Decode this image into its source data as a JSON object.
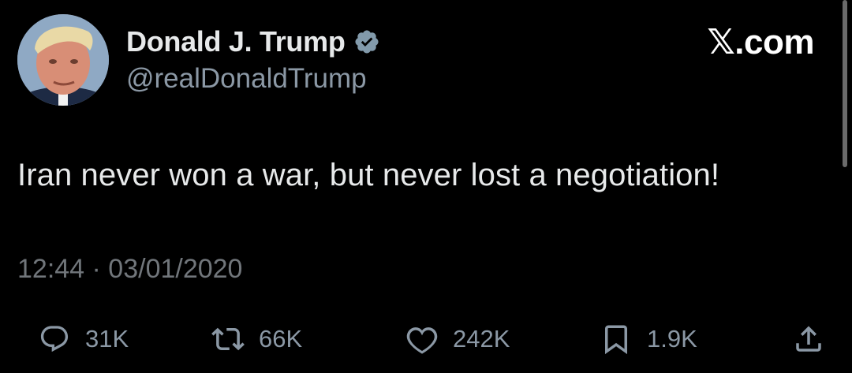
{
  "author": {
    "display_name": "Donald J. Trump",
    "handle": "@realDonaldTrump",
    "verified": true
  },
  "source_label": "𝕏.com",
  "tweet": {
    "text": "Iran never won a war, but never lost a negotiation!",
    "timestamp": "12:44 · 03/01/2020"
  },
  "actions": {
    "reply": {
      "icon": "reply-icon",
      "count": "31K"
    },
    "retweet": {
      "icon": "retweet-icon",
      "count": "66K"
    },
    "like": {
      "icon": "heart-icon",
      "count": "242K"
    },
    "bookmark": {
      "icon": "bookmark-icon",
      "count": "1.9K"
    },
    "share": {
      "icon": "share-icon"
    }
  },
  "colors": {
    "background": "#000000",
    "primary_text": "#e7e9ea",
    "secondary_text": "#8b98a5",
    "verified_badge": "#829aab"
  }
}
